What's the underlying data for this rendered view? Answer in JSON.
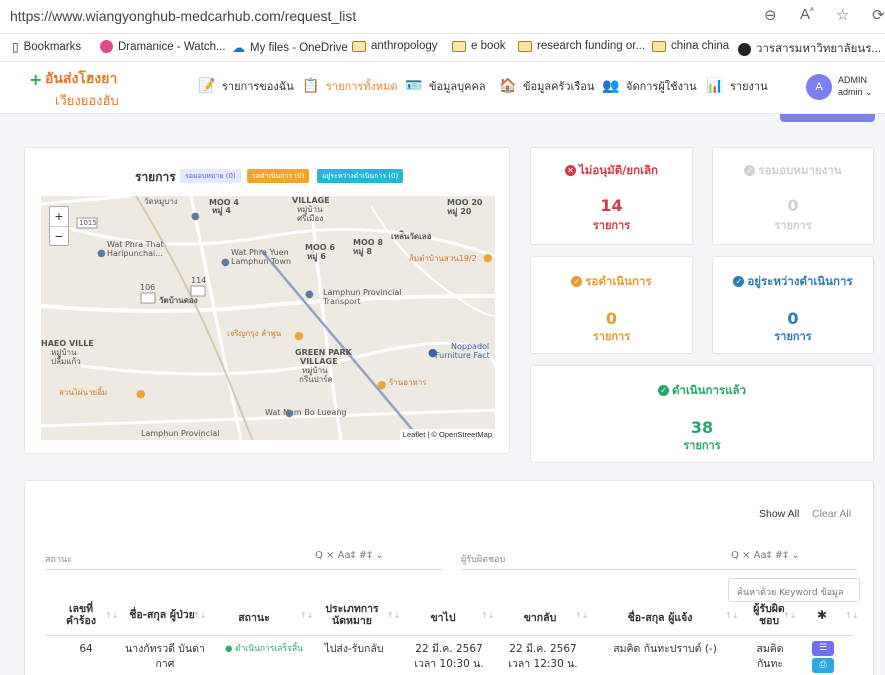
{
  "browser": {
    "url": "https://www.wiangyonghub-medcarhub.com/request_list",
    "bookmarks": [
      {
        "label": "Bookmarks",
        "icon": "bookmark-icon"
      },
      {
        "label": "Dramanice - Watch...",
        "icon": "dramanice-icon"
      },
      {
        "label": "My files - OneDrive",
        "icon": "onedrive-icon"
      },
      {
        "label": "anthropology",
        "icon": "folder-icon"
      },
      {
        "label": "e book",
        "icon": "folder-icon"
      },
      {
        "label": "research funding or...",
        "icon": "folder-icon"
      },
      {
        "label": "china china",
        "icon": "folder-icon"
      },
      {
        "label": "วารสารมหาวิทยาลัยนร...",
        "icon": "site-icon"
      }
    ]
  },
  "app": {
    "logo_line1": "อันส่งโฮงยา",
    "logo_line2": "เวียงยองฮับ",
    "nav": [
      {
        "label": "รายการของฉัน",
        "icon": "list-edit-icon"
      },
      {
        "label": "รายการทั้งหมด",
        "icon": "clipboard-icon"
      },
      {
        "label": "ข้อมูลบุคคล",
        "icon": "person-card-icon"
      },
      {
        "label": "ข้อมูลครัวเรือน",
        "icon": "house-icon"
      },
      {
        "label": "จัดการผู้ใช้งาน",
        "icon": "users-icon"
      },
      {
        "label": "รายงาน",
        "icon": "report-icon"
      }
    ],
    "avatar_text": "A",
    "admin_line1": "ADMIN",
    "admin_line2": "admin ⌄"
  },
  "map_card": {
    "title": "รายการ",
    "chips": [
      "รอมอบหมาย (0)",
      "รอดำเนินการ (0)",
      "อยู่ระหว่างดำเนินการ (0)"
    ],
    "attribution": "Leaflet | © OpenStreetMap",
    "labels": [
      "วัดหมูบาง",
      "MOO 4",
      "หมู่ 4",
      "VILLAGE",
      "หมู่บ้าน",
      "ศรีเมือง",
      "MOO 20",
      "หมู่ 20",
      "1015",
      "Wat Phra That",
      "Haripunchai...",
      "Wat Phra Yuen",
      "Lamphun Town",
      "MOO 6",
      "หมู่ 6",
      "MOO 8",
      "หมู่ 8",
      "เหล่ินวัดเลอ",
      "ส้มตำบ้านสวน19/2",
      "106",
      "114",
      "วัดบ้านดอง",
      "Lamphun Provincial",
      "Transport",
      "เจริญกรุง ลำพูน",
      "GREEN PARK",
      "VILLAGE",
      "หมู่บ้าน",
      "กรีนปาร์ค",
      "Noppadol",
      "Furniture Fact",
      "HAEO VILLE",
      "หมู่บ้าน",
      "ปลื้มแก้ว",
      "สวนไผ่นายอิ้ม",
      "ร้านอาหาร",
      "Wat Nam Bo Lueang",
      "Lamphun Provincial"
    ]
  },
  "stats": [
    {
      "title": "ไม่อนุมัติ/ยกเลิก",
      "value": "14",
      "unit": "รายการ",
      "color": "#d6394a"
    },
    {
      "title": "รอมอบหมายงาน",
      "value": "0",
      "unit": "รายการ",
      "color": "#cfcfcf"
    },
    {
      "title": "รอดำเนินการ",
      "value": "0",
      "unit": "รายการ",
      "color": "#e89a2c"
    },
    {
      "title": "อยู่ระหว่างดำเนินการ",
      "value": "0",
      "unit": "รายการ",
      "color": "#2a7db6"
    },
    {
      "title": "ดำเนินการแล้ว",
      "value": "38",
      "unit": "รายการ",
      "color": "#25a76b"
    }
  ],
  "table": {
    "show_all": "Show All",
    "clear_all": "Clear All",
    "filter_status_placeholder": "สถานะ",
    "filter_assignee_placeholder": "ผู้รับผิดชอบ",
    "filter_tools": "Q × Aa‡ #‡ ⌄",
    "keyword_placeholder": "ค้นหาด้วย Keyword ข้อมูล",
    "headers": [
      "เลขที่ คำร้อง",
      "ชื่อ-สกุล ผู้ป่วย",
      "สถานะ",
      "ประเภทการ นัดหมาย",
      "ขาไป",
      "ขากลับ",
      "ชื่อ-สกุล ผู้แจ้ง",
      "ผู้รับผิด ชอบ"
    ],
    "rows": [
      {
        "id": "64",
        "patient": "นางกัทรวดี บันดา กาศ",
        "status": "ดำเนินการเสร็จสิ้น",
        "type": "ไปส่ง-รับกลับ",
        "go": "22 มี.ค. 2567 เวลา 10:30 น.",
        "back": "22 มี.ค. 2567 เวลา 12:30 น.",
        "reporter": "สมคิด กันทะปราบต์ (-)",
        "assignee": "สมคิด กันทะ"
      }
    ]
  }
}
